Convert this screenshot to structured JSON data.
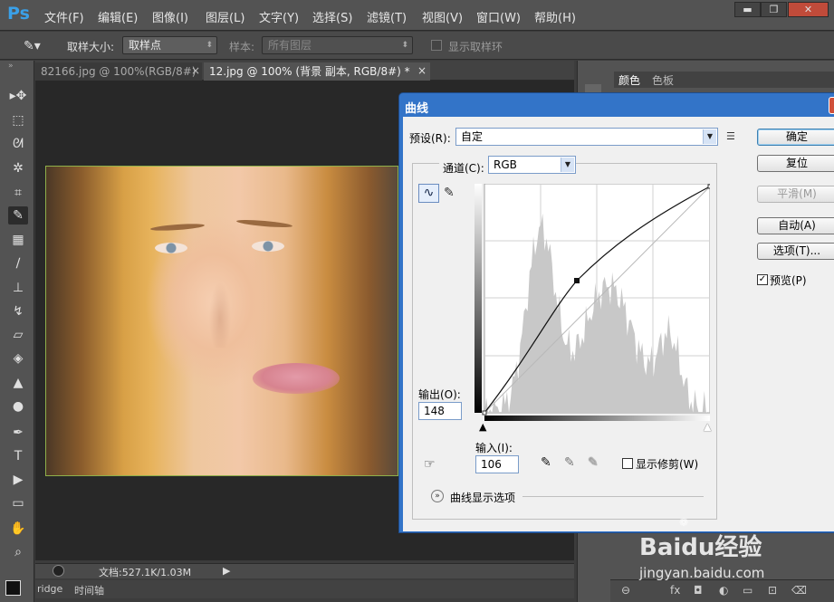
{
  "app": {
    "logo": "Ps"
  },
  "menu": [
    "文件(F)",
    "编辑(E)",
    "图像(I)",
    "图层(L)",
    "文字(Y)",
    "选择(S)",
    "滤镜(T)",
    "视图(V)",
    "窗口(W)",
    "帮助(H)"
  ],
  "window_controls": {
    "minimize": "▬",
    "restore": "❐",
    "close": "✕"
  },
  "options": {
    "sample_size_label": "取样大小:",
    "sample_size_value": "取样点",
    "sample_label": "样本:",
    "sample_value": "所有图层",
    "show_ring_label": "显示取样环"
  },
  "tabs": [
    {
      "label": "82166.jpg @ 100%(RGB/8#)",
      "close": "×"
    },
    {
      "label": "12.jpg @ 100% (背景 副本, RGB/8#) *",
      "close": "×"
    }
  ],
  "status": {
    "doc_info": "文档:527.1K/1.03M"
  },
  "bottom_tabs": [
    "ridge",
    "时间轴"
  ],
  "right_panel": {
    "tabs": [
      "颜色",
      "色板"
    ]
  },
  "tools": [
    "move-tool-icon",
    "marquee-tool-icon",
    "lasso-tool-icon",
    "magic-wand-icon",
    "crop-tool-icon",
    "eyedropper-tool-icon",
    "healing-brush-icon",
    "brush-tool-icon",
    "clone-stamp-icon",
    "history-brush-icon",
    "eraser-icon",
    "paint-bucket-icon",
    "blur-tool-icon",
    "dodge-tool-icon",
    "pen-tool-icon",
    "type-tool-icon",
    "path-select-icon",
    "shape-tool-icon",
    "hand-tool-icon",
    "zoom-tool-icon"
  ],
  "curves": {
    "title": "曲线",
    "preset_label": "预设(R):",
    "preset_value": "自定",
    "channel_label": "通道(C):",
    "channel_value": "RGB",
    "output_label": "输出(O):",
    "output_value": "148",
    "input_label": "输入(I):",
    "input_value": "106",
    "show_clipping_label": "显示修剪(W)",
    "display_options_label": "曲线显示选项",
    "buttons": {
      "ok": "确定",
      "reset": "复位",
      "smooth": "平滑(M)",
      "auto": "自动(A)",
      "options": "选项(T)..."
    },
    "preview_label": "预览(P)",
    "preview_checked": true
  },
  "watermark": {
    "brand": "Baidu经验",
    "url": "jingyan.baidu.com"
  }
}
